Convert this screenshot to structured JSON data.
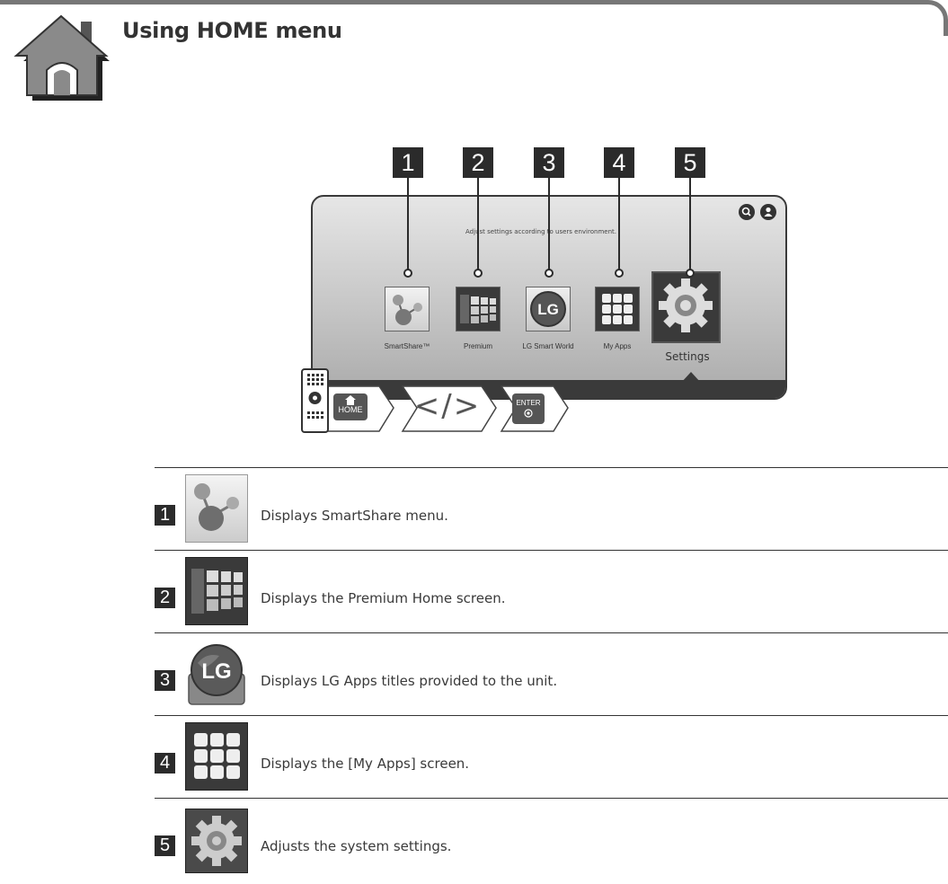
{
  "header": {
    "title": "Using HOME menu",
    "icon": "home-icon"
  },
  "diagram": {
    "callouts": [
      "1",
      "2",
      "3",
      "4",
      "5"
    ],
    "hint_text": "Adjust settings according to users environment.",
    "apps": [
      {
        "label": "SmartShare™",
        "icon": "smartshare-icon"
      },
      {
        "label": "Premium",
        "icon": "premium-icon"
      },
      {
        "label": "LG Smart World",
        "icon": "lg-smart-world-icon"
      },
      {
        "label": "My Apps",
        "icon": "my-apps-icon"
      }
    ],
    "settings_label": "Settings",
    "top_icons": [
      "search-icon",
      "user-icon"
    ],
    "steps": {
      "home_key": "HOME",
      "nav_key": "</>",
      "enter_key": "ENTER"
    }
  },
  "table": {
    "rows": [
      {
        "num": "1",
        "icon": "smartshare-icon",
        "description": "Displays SmartShare menu."
      },
      {
        "num": "2",
        "icon": "premium-icon",
        "description": "Displays the Premium Home screen."
      },
      {
        "num": "3",
        "icon": "lg-smart-world-icon",
        "description": "Displays LG Apps titles provided to the unit."
      },
      {
        "num": "4",
        "icon": "my-apps-icon",
        "description": "Displays the [My Apps] screen."
      },
      {
        "num": "5",
        "icon": "settings-icon",
        "description": "Adjusts the system settings."
      }
    ]
  }
}
